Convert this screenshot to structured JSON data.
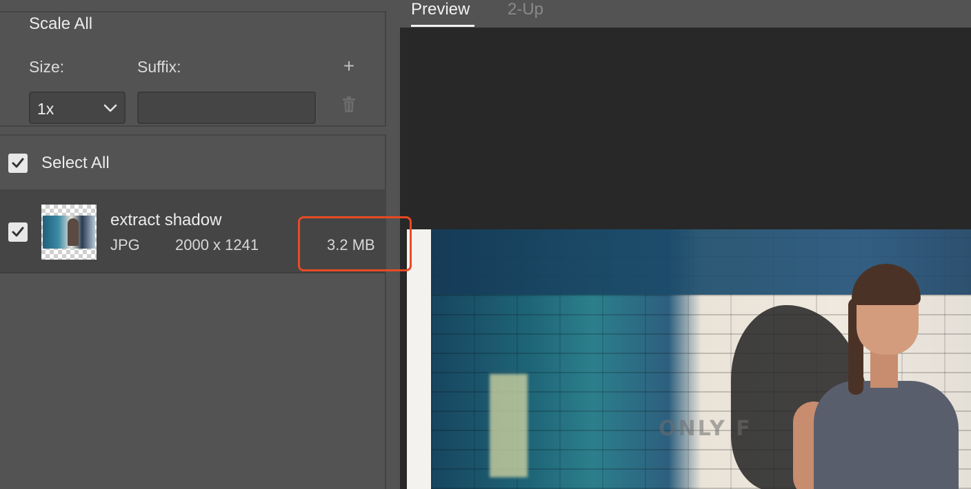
{
  "scale_all": {
    "legend": "Scale All",
    "size_label": "Size:",
    "suffix_label": "Suffix:",
    "add_icon": "plus-icon",
    "delete_icon": "trash-icon",
    "size_value": "1x",
    "suffix_value": ""
  },
  "list": {
    "select_all_label": "Select All",
    "select_all_checked": true,
    "items": [
      {
        "name": "extract shadow",
        "format": "JPG",
        "dimensions": "2000 x 1241",
        "size": "3.2 MB",
        "checked": true
      }
    ]
  },
  "preview": {
    "tabs": [
      {
        "label": "Preview",
        "active": true
      },
      {
        "label": "2-Up",
        "active": false
      }
    ],
    "watermark_text": "ONLY F"
  },
  "colors": {
    "highlight": "#ea4a24",
    "panel": "#535353",
    "canvas": "#282828"
  }
}
